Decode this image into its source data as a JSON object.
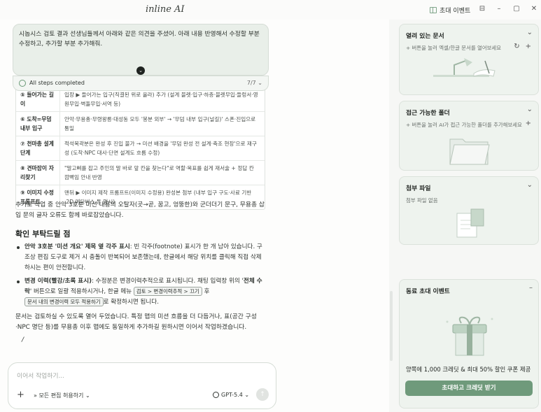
{
  "titlebar": {
    "logo": "inline AI",
    "invite_label": "초대 이벤트",
    "window_buttons": [
      "⊟",
      "–",
      "▢",
      "✕"
    ]
  },
  "prompt": {
    "text": "시놉시스 검토 결과 선생님들께서 아래와 같은 의견을 주셨어. 아래 내용 반영해서 수정할 부분 수정하고, 추가할 부분 추가해줘.",
    "steps_label": "All steps completed",
    "steps_count": "7/7"
  },
  "table_rows": [
    {
      "a": "⑤ 들어가는 길이",
      "b": "입장 ▶ 들어가는 입구(직결된 위로 올라) 추가 (설계 블렛·입구·하층·블렛무입·들렁서·영원무입·벽돌무입·서역 등)"
    },
    {
      "a": "⑥ 도착=무덤 내부 입구",
      "b": "안악·무용총·무령왕릉·대성동 모두 '봉분 외부' → '무덤 내부 입구(널길)' 스폰·진입으로 통일"
    },
    {
      "a": "⑦ 천마총 설계 단계",
      "b": "적석목곽분은 완성 후 진입 불가 → 미션 배경을 '무덤 완성 전 설계·축조 현장'으로 재구성 (도착·NPC 대사·단면 설계도 흐름 수정)"
    },
    {
      "a": "⑧ 견마잡이 자리찾기",
      "b": "\"말고삐를 잡고 주인의 말 바로 앞 칸을 찾는다\"로 역할·목표를 쉽게 재서술 + 정답 칸 깜빡임 안내 반영"
    },
    {
      "a": "⑨ 이미지 수정 프롬프트",
      "b": "맨뒤 ▶ 이미지 제작 프롬프트(이미지 수정용) 완성본 첨부 (내부 입구 구도·사료 기반·2D 메타버스 톤 명시)"
    }
  ],
  "body": {
    "para1": "추가로 작업 중 안악 3호분 미션 내용의 오탈자(곳→곧, 꿈고, 엉뚱한)와 군더더기 문구, 무용총 삽입 문의 글자 오류도 함께 바로잡았습니다.",
    "heading": "확인 부탁드릴 점",
    "bullet1_strong": "안악 3호분 '미션 개요' 제목 옆 각주 표시",
    "bullet1_rest": ": 빈 각주(footnote) 표시가 한 개 남아 있습니다. 구조상 편집 도구로 제거 시 충돌이 반복되어 보존했는데, 한글에서 해당 위치를 클릭해 직접 삭제하시는 편이 안전합니다.",
    "bullet2_strong": "변경 이력(빨강/초록 표시)",
    "bullet2_rest1": ": 수정분은 변경이력추적으로 표시됩니다. 채팅 입력창 위의 '",
    "bullet2_strong2": "전체 수락",
    "bullet2_rest2": "' 버튼으로 일괄 적용하시거나, 한글 메뉴",
    "kbd1": "검토 > 변경이력추적 > 끄기",
    "bullet2_mid": "후",
    "kbd2": "문서 내의 변경이력 모두 적용하기",
    "bullet2_end": "로 확정하시면 됩니다.",
    "para2": "문서는 검토하실 수 있도록 열어 두었습니다. 특정 맵의 미션 흐름을 더 다듬거나, 표(공간 구성·NPC 명단 등)를 무용총 이후 맵에도 동일하게 추가하길 원하시면 이어서 작업하겠습니다.",
    "cursor": "/"
  },
  "composer": {
    "placeholder": "이어서 작업하기...",
    "plus": "+",
    "mode": "» 모든 편집 허용하기 ⌄",
    "model": "GPT-5.4 ⌄",
    "send": "↑"
  },
  "right_panel": {
    "open_docs_title": "열려 있는 문서",
    "open_docs_hint": "+ 버튼을 눌러 엑셀/한글 문서를 열어보세요",
    "folders_title": "접근 가능한 폴더",
    "folders_hint": "+ 버튼을 눌러 AI가 접근 가능한 폴더를 추가해보세요",
    "attach_title": "첨부 파일",
    "attach_hint": "첨부 파일 없음",
    "invite_title": "동료 초대 이벤트",
    "invite_text": "양쪽에 1,000 크레딧 & 최대 50% 할인 쿠폰 제공",
    "invite_button": "초대하고 크레딧 받기",
    "chevron": "⌄",
    "collapse": "–",
    "refresh": "↻",
    "plus": "+"
  },
  "colors": {
    "accent": "#6f9a7b",
    "panel_bg": "#eef3ee"
  }
}
